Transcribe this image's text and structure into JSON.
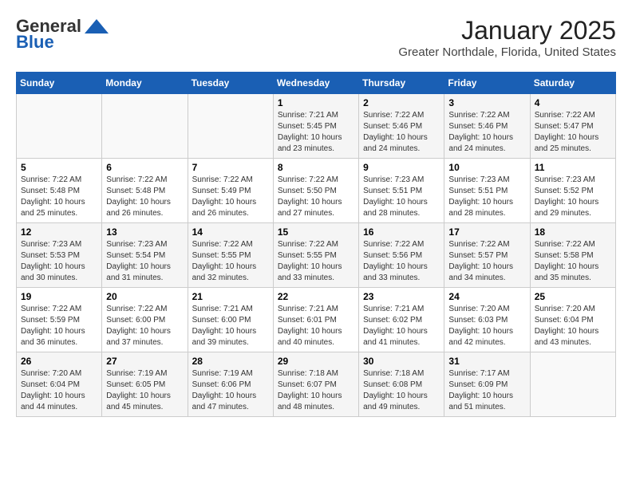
{
  "logo": {
    "text_general": "General",
    "text_blue": "Blue"
  },
  "title": {
    "month": "January 2025",
    "location": "Greater Northdale, Florida, United States"
  },
  "days_of_week": [
    "Sunday",
    "Monday",
    "Tuesday",
    "Wednesday",
    "Thursday",
    "Friday",
    "Saturday"
  ],
  "weeks": [
    [
      {
        "day": "",
        "info": ""
      },
      {
        "day": "",
        "info": ""
      },
      {
        "day": "",
        "info": ""
      },
      {
        "day": "1",
        "info": "Sunrise: 7:21 AM\nSunset: 5:45 PM\nDaylight: 10 hours\nand 23 minutes."
      },
      {
        "day": "2",
        "info": "Sunrise: 7:22 AM\nSunset: 5:46 PM\nDaylight: 10 hours\nand 24 minutes."
      },
      {
        "day": "3",
        "info": "Sunrise: 7:22 AM\nSunset: 5:46 PM\nDaylight: 10 hours\nand 24 minutes."
      },
      {
        "day": "4",
        "info": "Sunrise: 7:22 AM\nSunset: 5:47 PM\nDaylight: 10 hours\nand 25 minutes."
      }
    ],
    [
      {
        "day": "5",
        "info": "Sunrise: 7:22 AM\nSunset: 5:48 PM\nDaylight: 10 hours\nand 25 minutes."
      },
      {
        "day": "6",
        "info": "Sunrise: 7:22 AM\nSunset: 5:48 PM\nDaylight: 10 hours\nand 26 minutes."
      },
      {
        "day": "7",
        "info": "Sunrise: 7:22 AM\nSunset: 5:49 PM\nDaylight: 10 hours\nand 26 minutes."
      },
      {
        "day": "8",
        "info": "Sunrise: 7:22 AM\nSunset: 5:50 PM\nDaylight: 10 hours\nand 27 minutes."
      },
      {
        "day": "9",
        "info": "Sunrise: 7:23 AM\nSunset: 5:51 PM\nDaylight: 10 hours\nand 28 minutes."
      },
      {
        "day": "10",
        "info": "Sunrise: 7:23 AM\nSunset: 5:51 PM\nDaylight: 10 hours\nand 28 minutes."
      },
      {
        "day": "11",
        "info": "Sunrise: 7:23 AM\nSunset: 5:52 PM\nDaylight: 10 hours\nand 29 minutes."
      }
    ],
    [
      {
        "day": "12",
        "info": "Sunrise: 7:23 AM\nSunset: 5:53 PM\nDaylight: 10 hours\nand 30 minutes."
      },
      {
        "day": "13",
        "info": "Sunrise: 7:23 AM\nSunset: 5:54 PM\nDaylight: 10 hours\nand 31 minutes."
      },
      {
        "day": "14",
        "info": "Sunrise: 7:22 AM\nSunset: 5:55 PM\nDaylight: 10 hours\nand 32 minutes."
      },
      {
        "day": "15",
        "info": "Sunrise: 7:22 AM\nSunset: 5:55 PM\nDaylight: 10 hours\nand 33 minutes."
      },
      {
        "day": "16",
        "info": "Sunrise: 7:22 AM\nSunset: 5:56 PM\nDaylight: 10 hours\nand 33 minutes."
      },
      {
        "day": "17",
        "info": "Sunrise: 7:22 AM\nSunset: 5:57 PM\nDaylight: 10 hours\nand 34 minutes."
      },
      {
        "day": "18",
        "info": "Sunrise: 7:22 AM\nSunset: 5:58 PM\nDaylight: 10 hours\nand 35 minutes."
      }
    ],
    [
      {
        "day": "19",
        "info": "Sunrise: 7:22 AM\nSunset: 5:59 PM\nDaylight: 10 hours\nand 36 minutes."
      },
      {
        "day": "20",
        "info": "Sunrise: 7:22 AM\nSunset: 6:00 PM\nDaylight: 10 hours\nand 37 minutes."
      },
      {
        "day": "21",
        "info": "Sunrise: 7:21 AM\nSunset: 6:00 PM\nDaylight: 10 hours\nand 39 minutes."
      },
      {
        "day": "22",
        "info": "Sunrise: 7:21 AM\nSunset: 6:01 PM\nDaylight: 10 hours\nand 40 minutes."
      },
      {
        "day": "23",
        "info": "Sunrise: 7:21 AM\nSunset: 6:02 PM\nDaylight: 10 hours\nand 41 minutes."
      },
      {
        "day": "24",
        "info": "Sunrise: 7:20 AM\nSunset: 6:03 PM\nDaylight: 10 hours\nand 42 minutes."
      },
      {
        "day": "25",
        "info": "Sunrise: 7:20 AM\nSunset: 6:04 PM\nDaylight: 10 hours\nand 43 minutes."
      }
    ],
    [
      {
        "day": "26",
        "info": "Sunrise: 7:20 AM\nSunset: 6:04 PM\nDaylight: 10 hours\nand 44 minutes."
      },
      {
        "day": "27",
        "info": "Sunrise: 7:19 AM\nSunset: 6:05 PM\nDaylight: 10 hours\nand 45 minutes."
      },
      {
        "day": "28",
        "info": "Sunrise: 7:19 AM\nSunset: 6:06 PM\nDaylight: 10 hours\nand 47 minutes."
      },
      {
        "day": "29",
        "info": "Sunrise: 7:18 AM\nSunset: 6:07 PM\nDaylight: 10 hours\nand 48 minutes."
      },
      {
        "day": "30",
        "info": "Sunrise: 7:18 AM\nSunset: 6:08 PM\nDaylight: 10 hours\nand 49 minutes."
      },
      {
        "day": "31",
        "info": "Sunrise: 7:17 AM\nSunset: 6:09 PM\nDaylight: 10 hours\nand 51 minutes."
      },
      {
        "day": "",
        "info": ""
      }
    ]
  ]
}
